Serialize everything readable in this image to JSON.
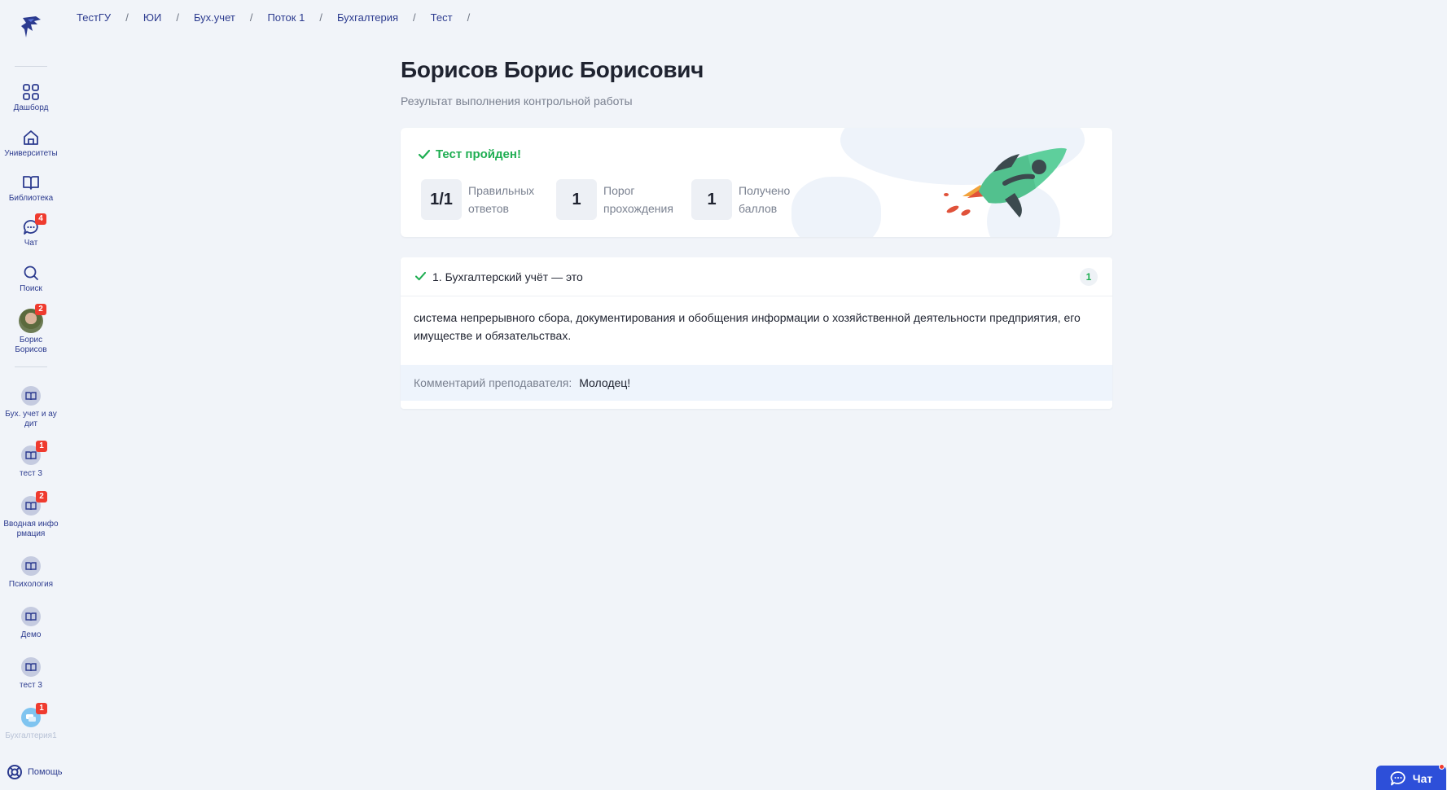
{
  "breadcrumb": [
    "ТестГУ",
    "ЮИ",
    "Бух.учет",
    "Поток 1",
    "Бухгалтерия",
    "Тест"
  ],
  "breadcrumb_separator": "/",
  "sidebar": {
    "nav": [
      {
        "label": "Дашборд",
        "icon": "grid-icon"
      },
      {
        "label": "Университеты",
        "icon": "home-icon"
      },
      {
        "label": "Библиотека",
        "icon": "book-icon"
      },
      {
        "label": "Чат",
        "icon": "chat-icon",
        "badge": "4"
      },
      {
        "label": "Поиск",
        "icon": "search-icon"
      }
    ],
    "profile": {
      "label_line1": "Борис",
      "label_line2": "Борисов",
      "badge": "2"
    },
    "courses": [
      {
        "label_line1": "Бух. учет и ау",
        "label_line2": "дит",
        "badge": ""
      },
      {
        "label_line1": "тест 3",
        "label_line2": "",
        "badge": "1"
      },
      {
        "label_line1": "Вводная инфо",
        "label_line2": "рмация",
        "badge": "2"
      },
      {
        "label_line1": "Психология",
        "label_line2": "",
        "badge": ""
      },
      {
        "label_line1": "Демо",
        "label_line2": "",
        "badge": ""
      },
      {
        "label_line1": "тест 3",
        "label_line2": "",
        "badge": ""
      },
      {
        "label_line1": "Бухгалтерия1",
        "label_line2": "",
        "badge": "1"
      }
    ],
    "help_label": "Помощь"
  },
  "page": {
    "title": "Борисов Борис Борисович",
    "subtitle": "Результат выполнения контрольной работы"
  },
  "result": {
    "status": "Тест пройден!",
    "stats": [
      {
        "value": "1/1",
        "label": "Правильных ответов"
      },
      {
        "value": "1",
        "label": "Порог прохождения"
      },
      {
        "value": "1",
        "label": "Получено баллов"
      }
    ]
  },
  "question": {
    "title": "1. Бухгалтерский учёт — это",
    "score": "1",
    "answer": "система непрерывного сбора, документирования и обобщения информации о хозяйственной деятельности предприятия, его имуществе и обязательствах.",
    "comment_label": "Комментарий преподавателя:",
    "comment_value": "Молодец!"
  },
  "chat_button": {
    "label": "Чат"
  },
  "colors": {
    "accent": "#2c3b8f",
    "success": "#1fae52",
    "badge": "#ef3b2f",
    "chat_button": "#2d4fd9"
  }
}
